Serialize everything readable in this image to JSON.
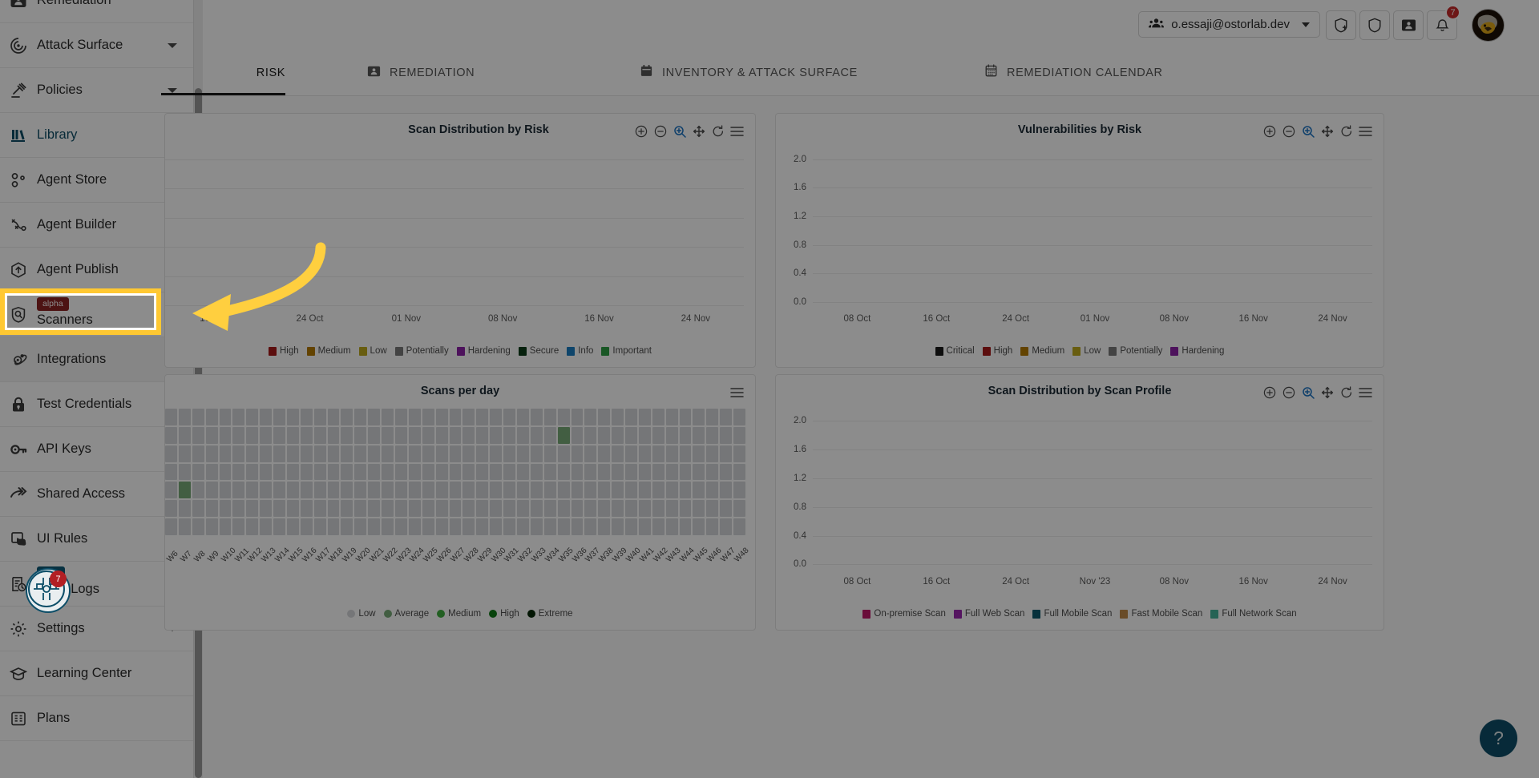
{
  "sidebar": {
    "items": [
      {
        "label": "Remediation",
        "icon": "remediation-icon",
        "caret": "none",
        "badge": null
      },
      {
        "label": "Attack Surface",
        "icon": "target-icon",
        "caret": "down",
        "badge": null
      },
      {
        "label": "Policies",
        "icon": "gavel-icon",
        "caret": "down",
        "badge": null
      },
      {
        "label": "Library",
        "icon": "library-icon",
        "caret": "up",
        "badge": null
      },
      {
        "label": "Agent Store",
        "icon": "agent-store-icon",
        "caret": "none",
        "badge": null
      },
      {
        "label": "Agent Builder",
        "icon": "agent-builder-icon",
        "caret": "none",
        "badge": null
      },
      {
        "label": "Agent Publish",
        "icon": "agent-publish-icon",
        "caret": "none",
        "badge": null
      },
      {
        "label": "Scanners",
        "icon": "scanner-shield-icon",
        "caret": "none",
        "badge": "alpha"
      },
      {
        "label": "Integrations",
        "icon": "integrations-icon",
        "caret": "none",
        "badge": null
      },
      {
        "label": "Test Credentials",
        "icon": "lock-icon",
        "caret": "none",
        "badge": null
      },
      {
        "label": "API Keys",
        "icon": "key-icon",
        "caret": "none",
        "badge": null
      },
      {
        "label": "Shared Access",
        "icon": "share-arrow-icon",
        "caret": "none",
        "badge": null
      },
      {
        "label": "UI Rules",
        "icon": "ui-rules-icon",
        "caret": "none",
        "badge": null
      },
      {
        "label": "Audit Logs",
        "icon": "audit-logs-icon",
        "caret": "none",
        "badge": "New"
      },
      {
        "label": "Settings",
        "icon": "gear-icon",
        "caret": "down",
        "badge": null
      },
      {
        "label": "Learning Center",
        "icon": "graduation-cap-icon",
        "caret": "none",
        "badge": null
      },
      {
        "label": "Plans",
        "icon": "plans-icon",
        "caret": "none",
        "badge": null
      }
    ],
    "highlighted_item": "Integrations",
    "floating_badge_count": "7",
    "highlight_color": "#ffc832"
  },
  "topbar": {
    "account": "o.essaji@ostorlab.dev",
    "account_icon": "users-icon",
    "icons": [
      "shield-plus-icon",
      "shield-icon",
      "ticket-icon",
      "bell-icon"
    ],
    "notification_count": "7",
    "avatar": "user-avatar"
  },
  "tabs": [
    {
      "label": "RISK",
      "icon": null,
      "active": true
    },
    {
      "label": "REMEDIATION",
      "icon": "ticket-icon",
      "active": false
    },
    {
      "label": "INVENTORY & ATTACK SURFACE",
      "icon": "inventory-icon",
      "active": false
    },
    {
      "label": "REMEDIATION CALENDAR",
      "icon": "calendar-icon",
      "active": false
    }
  ],
  "chart_toolbar": {
    "buttons": [
      "zoom-in-icon",
      "zoom-out-icon",
      "selection-zoom-icon",
      "panning-icon",
      "reset-zoom-icon",
      "menu-icon"
    ],
    "active": "selection-zoom-icon",
    "active_color": "#1a74c4"
  },
  "help_button": {
    "label": "?"
  },
  "chart_data": [
    {
      "type": "area",
      "title": "Scan Distribution by Risk",
      "xlabel": "",
      "ylabel": "",
      "x_ticks": [
        "16 Oct",
        "24 Oct",
        "01 Nov",
        "08 Nov",
        "16 Nov",
        "24 Nov"
      ],
      "y_ticks": [],
      "grid": true,
      "legend_position": "bottom",
      "series": [
        {
          "name": "High",
          "color": "#a81a1a",
          "values": []
        },
        {
          "name": "Medium",
          "color": "#b57a00",
          "values": []
        },
        {
          "name": "Low",
          "color": "#bdaa1e",
          "values": []
        },
        {
          "name": "Potentially",
          "color": "#7a7a7a",
          "values": []
        },
        {
          "name": "Hardening",
          "color": "#8d21a8",
          "values": []
        },
        {
          "name": "Secure",
          "color": "#0b3d18",
          "values": []
        },
        {
          "name": "Info",
          "color": "#1a7fc4",
          "values": []
        },
        {
          "name": "Important",
          "color": "#2f9e44",
          "values": []
        }
      ]
    },
    {
      "type": "area",
      "title": "Vulnerabilities by Risk",
      "xlabel": "",
      "ylabel": "",
      "x_ticks": [
        "08 Oct",
        "16 Oct",
        "24 Oct",
        "01 Nov",
        "08 Nov",
        "16 Nov",
        "24 Nov"
      ],
      "y_ticks": [
        "0.0",
        "0.4",
        "0.8",
        "1.2",
        "1.6",
        "2.0"
      ],
      "ylim": [
        0,
        2.0
      ],
      "grid": true,
      "legend_position": "bottom",
      "series": [
        {
          "name": "Critical",
          "color": "#1a1a1a",
          "values": []
        },
        {
          "name": "High",
          "color": "#a81a1a",
          "values": []
        },
        {
          "name": "Medium",
          "color": "#b57a00",
          "values": []
        },
        {
          "name": "Low",
          "color": "#bdaa1e",
          "values": []
        },
        {
          "name": "Potentially",
          "color": "#7a7a7a",
          "values": []
        },
        {
          "name": "Hardening",
          "color": "#8d21a8",
          "values": []
        }
      ]
    },
    {
      "type": "heatmap",
      "title": "Scans per day",
      "xlabel": "",
      "ylabel": "",
      "x_ticks": [
        "W6",
        "W7",
        "W8",
        "W9",
        "W10",
        "W11",
        "W12",
        "W13",
        "W14",
        "W15",
        "W16",
        "W17",
        "W18",
        "W19",
        "W20",
        "W21",
        "W22",
        "W23",
        "W24",
        "W25",
        "W26",
        "W27",
        "W28",
        "W29",
        "W30",
        "W31",
        "W32",
        "W33",
        "W34",
        "W35",
        "W36",
        "W37",
        "W38",
        "W39",
        "W40",
        "W41",
        "W42",
        "W43",
        "W44",
        "W45",
        "W46",
        "W47",
        "W48"
      ],
      "rows": 7,
      "grid": true,
      "legend_position": "bottom",
      "legend": [
        {
          "name": "Low",
          "color": "#d6d8da"
        },
        {
          "name": "Average",
          "color": "#78ab78"
        },
        {
          "name": "Medium",
          "color": "#3fae3f"
        },
        {
          "name": "High",
          "color": "#0f7a16"
        },
        {
          "name": "Extreme",
          "color": "#062808"
        }
      ],
      "highlighted_cells": [
        {
          "week": "W7",
          "row": 4,
          "level": "Average"
        },
        {
          "week": "W35",
          "row": 1,
          "level": "Average"
        }
      ]
    },
    {
      "type": "area",
      "title": "Scan Distribution by Scan Profile",
      "xlabel": "",
      "ylabel": "",
      "x_ticks": [
        "08 Oct",
        "16 Oct",
        "24 Oct",
        "Nov '23",
        "08 Nov",
        "16 Nov",
        "24 Nov"
      ],
      "y_ticks": [
        "0.0",
        "0.4",
        "0.8",
        "1.2",
        "1.6",
        "2.0"
      ],
      "ylim": [
        0,
        2.0
      ],
      "grid": true,
      "legend_position": "bottom",
      "series": [
        {
          "name": "On-premise Scan",
          "color": "#c2186b",
          "values": []
        },
        {
          "name": "Full Web Scan",
          "color": "#9c27b0",
          "values": []
        },
        {
          "name": "Full Mobile Scan",
          "color": "#0d5a6e",
          "values": []
        },
        {
          "name": "Fast Mobile Scan",
          "color": "#c08a4a",
          "values": []
        },
        {
          "name": "Full Network Scan",
          "color": "#45b59b",
          "values": []
        }
      ]
    }
  ]
}
